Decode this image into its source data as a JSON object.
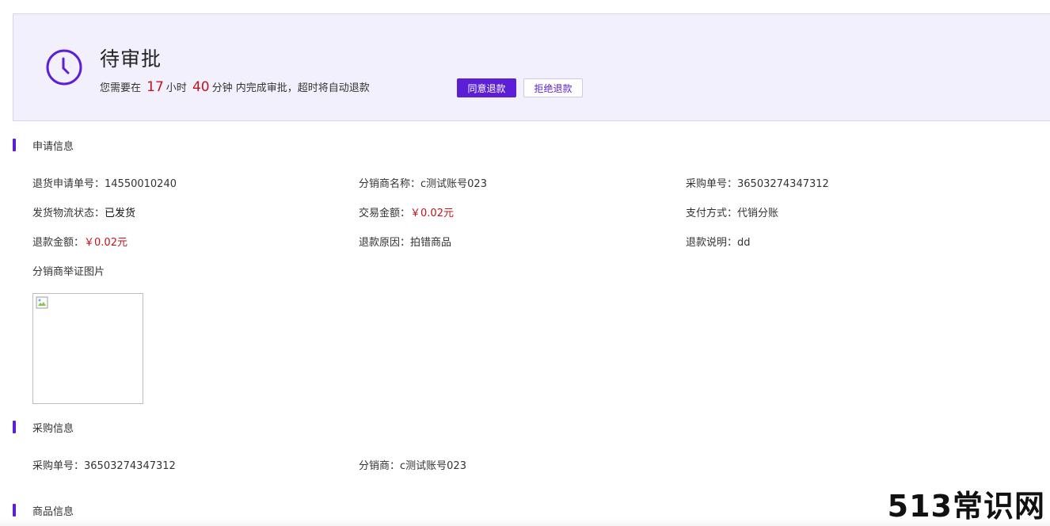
{
  "banner": {
    "title": "待审批",
    "countdown_prefix": "您需要在",
    "hours": "17",
    "hours_unit": "小时",
    "minutes": "40",
    "minutes_unit": "分钟",
    "countdown_suffix": "内完成审批，超时将自动退款",
    "agree_label": "同意退款",
    "reject_label": "拒绝退款"
  },
  "application": {
    "heading": "申请信息",
    "fields": [
      {
        "label": "退货申请单号：",
        "value": "14550010240"
      },
      {
        "label": "分销商名称：",
        "value": "c测试账号023"
      },
      {
        "label": "采购单号：",
        "value": "36503274347312"
      },
      {
        "label": "发货物流状态：",
        "value": "已发货"
      },
      {
        "label": "交易金额：",
        "value": "￥0.02元"
      },
      {
        "label": "支付方式：",
        "value": "代销分账"
      },
      {
        "label": "退款金额：",
        "value": "￥0.02元"
      },
      {
        "label": "退款原因：",
        "value": "拍错商品"
      },
      {
        "label": "退款说明：",
        "value": "dd"
      }
    ],
    "evidence_label": "分销商举证图片"
  },
  "purchase": {
    "heading": "采购信息",
    "fields": [
      {
        "label": "采购单号：",
        "value": "36503274347312"
      },
      {
        "label": "分销商：",
        "value": "c测试账号023"
      }
    ]
  },
  "product": {
    "heading": "商品信息"
  },
  "watermark": "513常识网",
  "colors": {
    "accent": "#5b1fd6",
    "banner_bg": "#f3f0fd",
    "highlight": "#c0151a"
  }
}
